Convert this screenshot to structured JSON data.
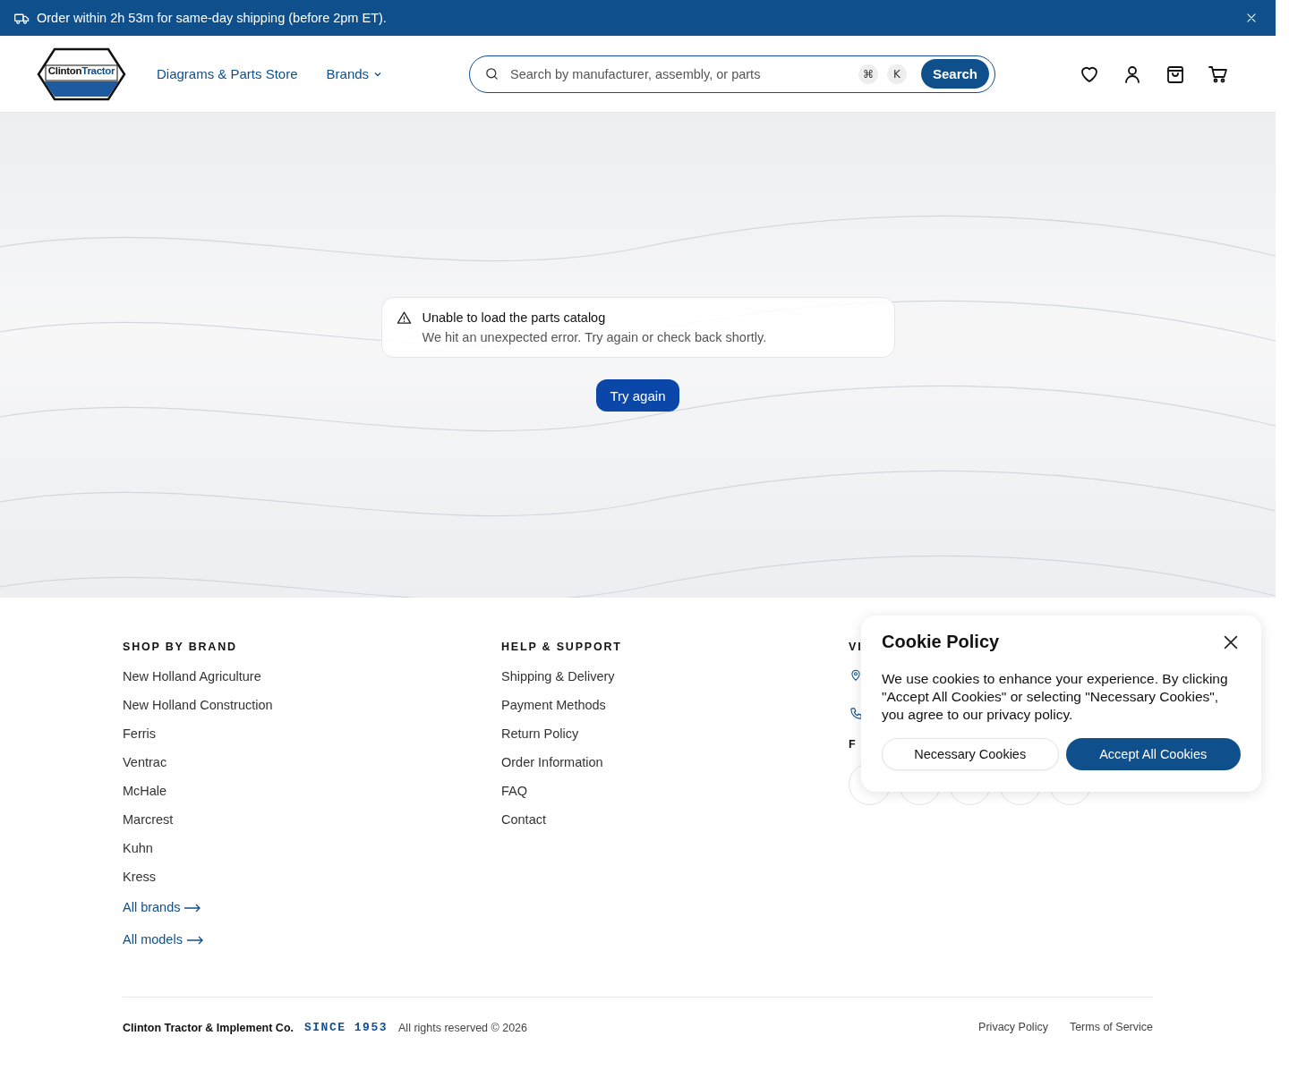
{
  "banner": {
    "message": "Order within 2h 53m for same-day shipping (before 2pm ET)."
  },
  "header": {
    "logo": {
      "word_1": "Clinton",
      "word_2": "Tractor"
    },
    "nav": [
      {
        "label": "Diagrams & Parts Store",
        "kind": "link"
      },
      {
        "label": "Brands",
        "kind": "dropdown"
      }
    ],
    "search": {
      "placeholder": "Search by manufacturer, assembly, or parts",
      "shortcut": [
        "⌘",
        "K"
      ],
      "button": "Search"
    }
  },
  "error": {
    "title": "Unable to load the parts catalog",
    "message": "We hit an unexpected error. Try again or check back shortly.",
    "button": "Try again"
  },
  "footer": {
    "columns": [
      {
        "heading": "SHOP BY BRAND",
        "links": [
          "New Holland Agriculture",
          "New Holland Construction",
          "Ferris",
          "Ventrac",
          "McHale",
          "Marcrest",
          "Kuhn",
          "Kress"
        ],
        "more_links": [
          "All brands",
          "All models"
        ]
      },
      {
        "heading": "HELP & SUPPORT",
        "links": [
          "Shipping & Delivery",
          "Payment Methods",
          "Return Policy",
          "Order Information",
          "FAQ",
          "Contact"
        ]
      },
      {
        "heading": "VI",
        "second_heading": "F"
      }
    ],
    "bottom": {
      "company": "Clinton Tractor & Implement Co.",
      "since": "SINCE 1953",
      "rights": "All rights reserved © 2026",
      "links": [
        "Privacy Policy",
        "Terms of Service"
      ]
    }
  },
  "cookie": {
    "title": "Cookie Policy",
    "text": "We use cookies to enhance your experience. By clicking \"Accept All Cookies\" or selecting \"Necessary Cookies\", you agree to our privacy policy.",
    "buttons": [
      {
        "label": "Necessary Cookies",
        "kind": "secondary"
      },
      {
        "label": "Accept All Cookies",
        "kind": "primary"
      }
    ]
  }
}
